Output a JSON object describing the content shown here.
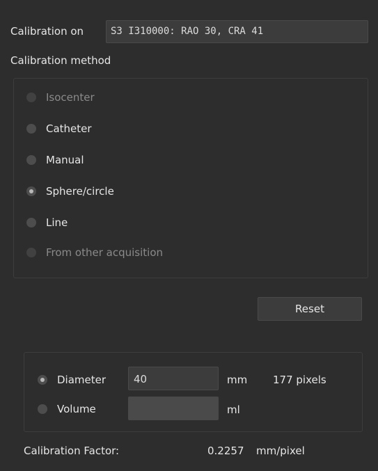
{
  "calibration_on": {
    "label": "Calibration on",
    "value": "S3 I310000: RAO 30, CRA 41"
  },
  "calibration_method": {
    "title": "Calibration method",
    "options": [
      {
        "label": "Isocenter",
        "enabled": false,
        "checked": false
      },
      {
        "label": "Catheter",
        "enabled": true,
        "checked": false
      },
      {
        "label": "Manual",
        "enabled": true,
        "checked": false
      },
      {
        "label": "Sphere/circle",
        "enabled": true,
        "checked": true
      },
      {
        "label": "Line",
        "enabled": true,
        "checked": false
      },
      {
        "label": "From other acquisition",
        "enabled": false,
        "checked": false
      }
    ]
  },
  "reset_label": "Reset",
  "sphere": {
    "diameter_label": "Diameter",
    "diameter_value": "40",
    "diameter_unit": "mm",
    "diameter_pixels": "177 pixels",
    "diameter_checked": true,
    "volume_label": "Volume",
    "volume_value": "",
    "volume_unit": "ml",
    "volume_checked": false
  },
  "calibration_factor": {
    "label": "Calibration Factor:",
    "value": "0.2257",
    "unit": "mm/pixel"
  }
}
